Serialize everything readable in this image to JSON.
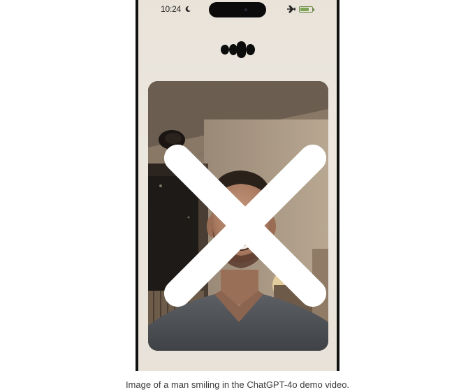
{
  "status_bar": {
    "time": "10:24",
    "moon_icon": "moon-icon",
    "airplane_icon": "airplane-icon",
    "battery_icon": "battery-icon"
  },
  "voice_indicator": {
    "icon": "voice-activity-blobs"
  },
  "camera": {
    "close_icon": "close-icon",
    "subject": "man-smiling-photo"
  },
  "caption": "Image of a man smiling in the ChatGPT-4o demo video.",
  "colors": {
    "screen_background": "#ece7df",
    "blob": "#0c0c0c",
    "battery": "#7fa556"
  }
}
